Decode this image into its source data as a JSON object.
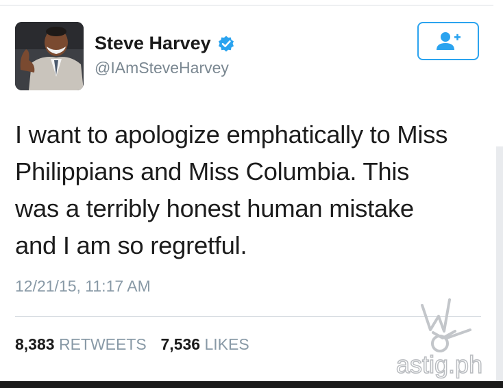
{
  "tweet": {
    "author": {
      "display_name": "Steve Harvey",
      "handle": "@IAmSteveHarvey",
      "verified": true
    },
    "follow_button": {
      "icon": "add-user-icon",
      "color": "#2aa3ef"
    },
    "text_lines": [
      "I want to apologize emphatically to Miss",
      "Philippians and Miss Columbia. This",
      "was a terribly honest human mistake",
      "and I am so regretful."
    ],
    "timestamp": "12/21/15, 11:17 AM",
    "stats": {
      "retweets_count": "8,383",
      "retweets_label": "RETWEETS",
      "likes_count": "7,536",
      "likes_label": "LIKES"
    }
  },
  "watermark": {
    "text": "astig.ph"
  },
  "colors": {
    "accent": "#2aa3ef",
    "muted_text": "#8899a6",
    "body_text": "#1c1c1c"
  }
}
